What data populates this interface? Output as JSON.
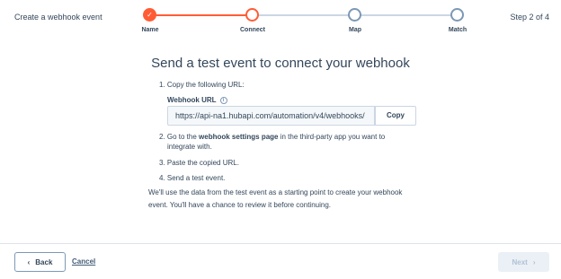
{
  "header": {
    "title": "Create a webhook event",
    "step_indicator": "Step 2 of 4"
  },
  "progress": {
    "steps": [
      {
        "label": "Name",
        "state": "done"
      },
      {
        "label": "Connect",
        "state": "current"
      },
      {
        "label": "Map",
        "state": "pending"
      },
      {
        "label": "Match",
        "state": "pending"
      }
    ]
  },
  "main": {
    "title": "Send a test event to connect your webhook",
    "step1": "1. Copy the following URL:",
    "url_label": "Webhook URL",
    "url_value": "https://api-na1.hubapi.com/automation/v4/webhooks/",
    "copy_label": "Copy",
    "step2_prefix": "2. Go to the ",
    "step2_bold": "webhook settings page",
    "step2_suffix": " in the third-party app you want to",
    "step2_line2": "integrate with.",
    "step3": "3. Paste the copied URL.",
    "step4": "4. Send a test event.",
    "note_line1": "We'll use the data from the test event as a starting point to create your webhook",
    "note_line2": "event. You'll have a chance to review it before continuing."
  },
  "footer": {
    "back_label": "Back",
    "cancel_label": "Cancel",
    "next_label": "Next"
  },
  "colors": {
    "accent": "#ff5c35",
    "text": "#33475b",
    "border": "#cbd6e2"
  }
}
